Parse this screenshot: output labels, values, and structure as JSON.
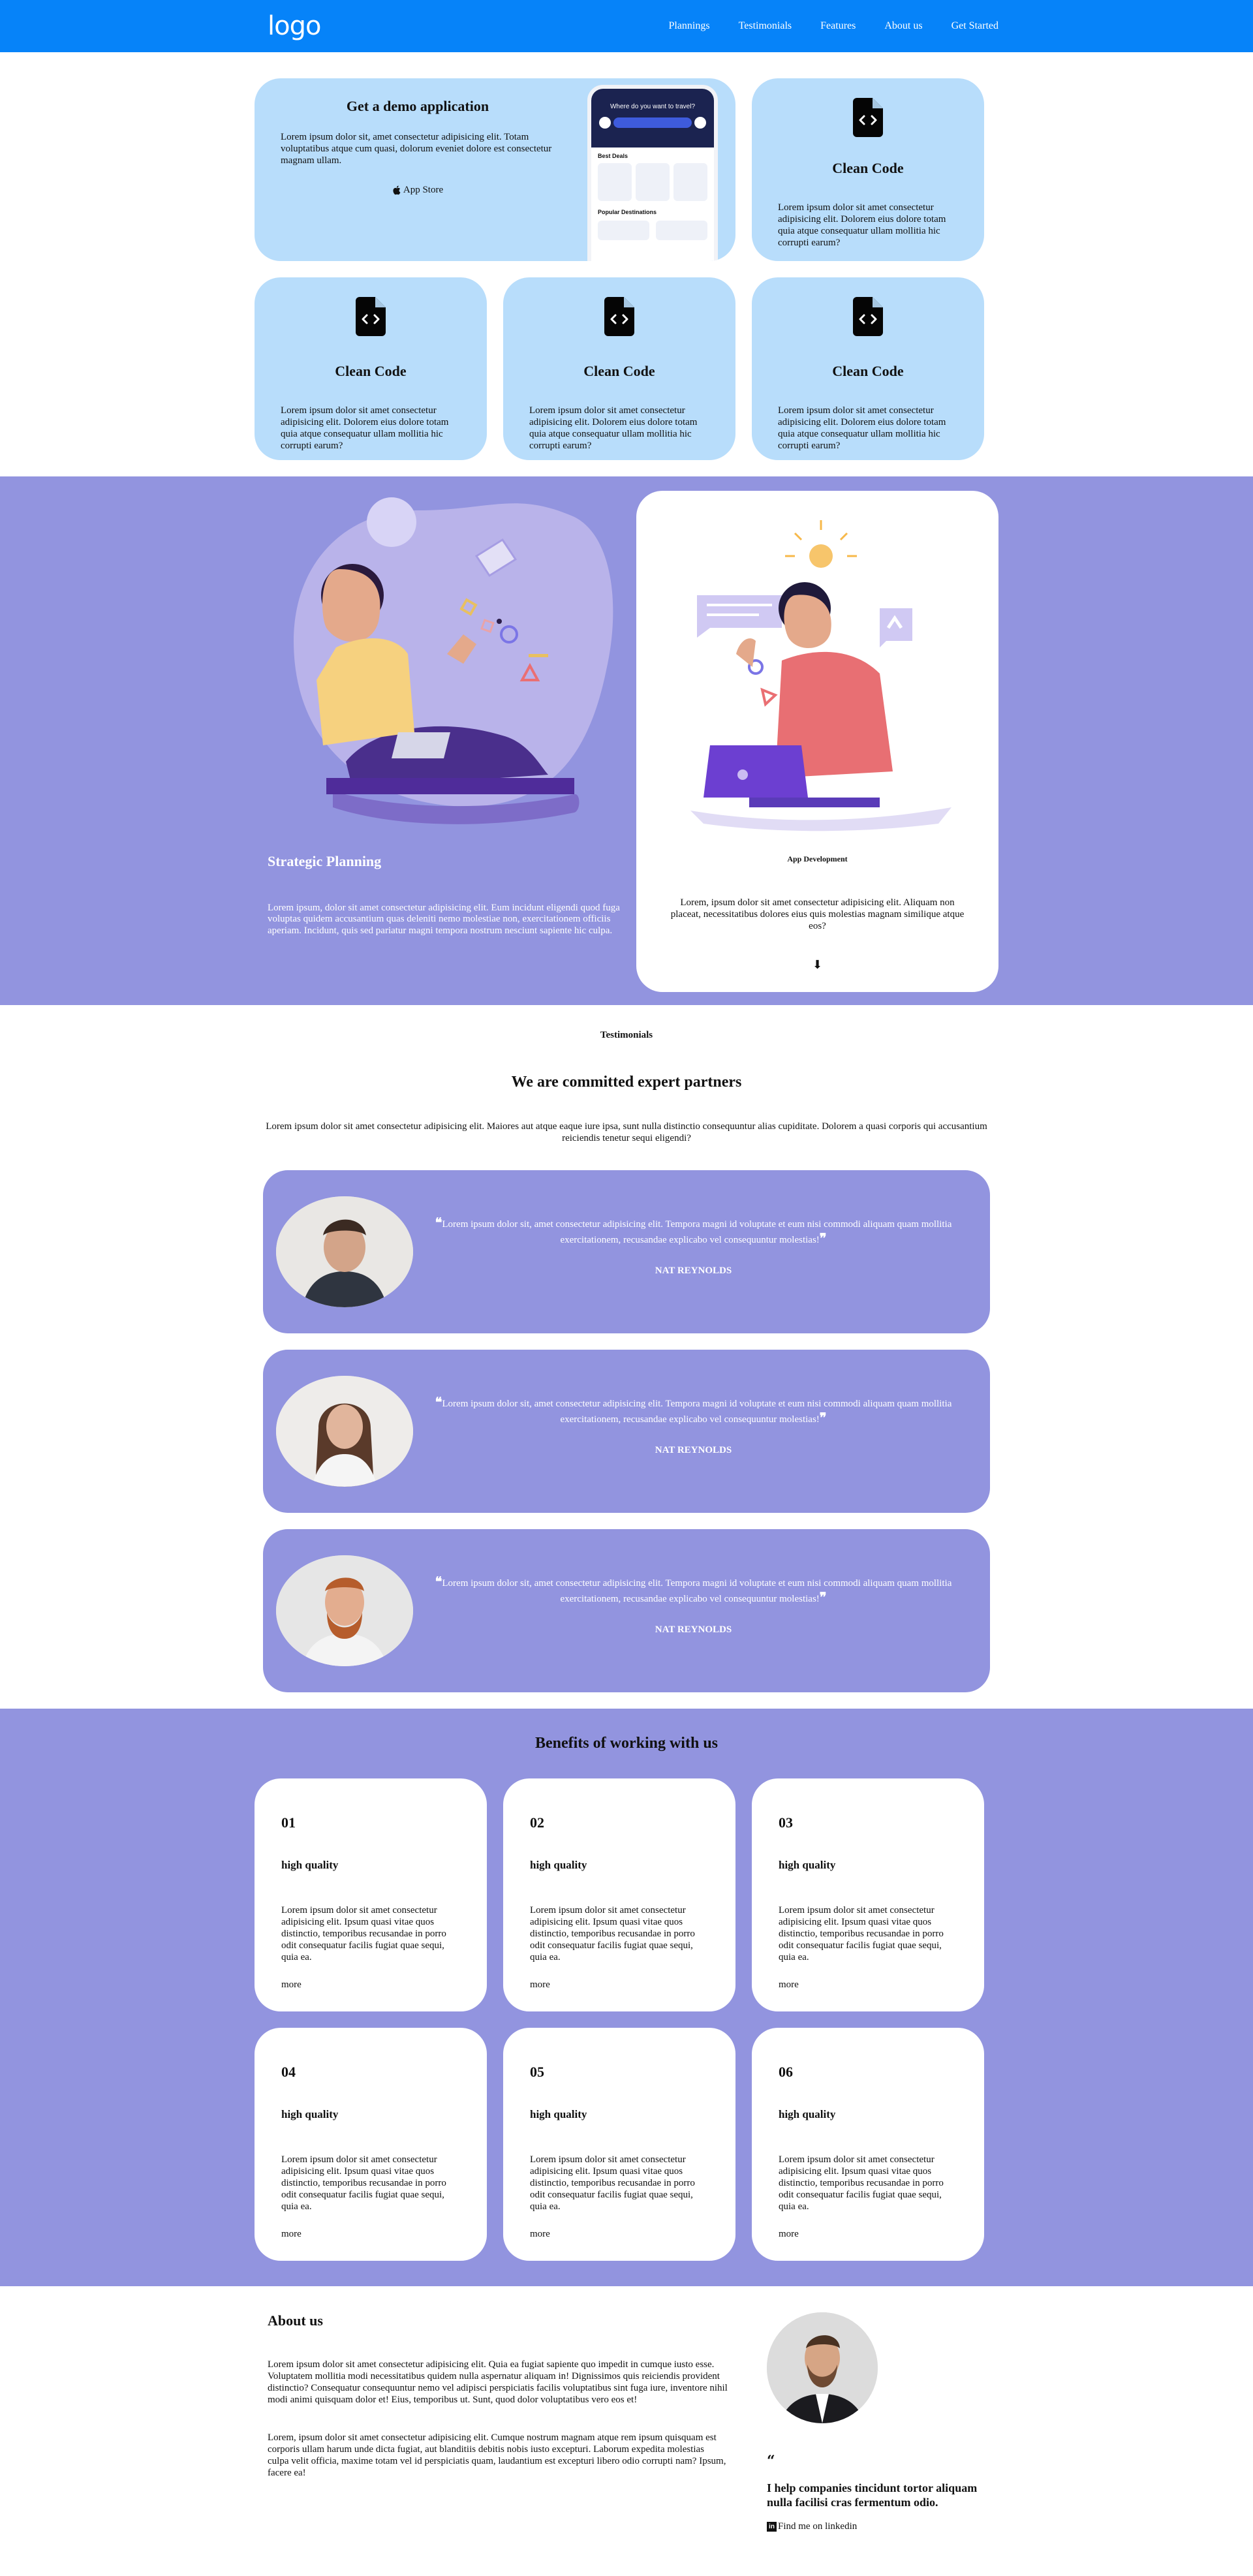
{
  "nav": {
    "logo": "logo",
    "links": [
      "Plannings",
      "Testimonials",
      "Features",
      "About us",
      "Get Started"
    ],
    "bg_color": "#0683f9"
  },
  "demo": {
    "title": "Get a demo application",
    "text": "Lorem ipsum dolor sit, amet consectetur adipisicing elit. Totam voluptatibus atque cum quasi, dolorum eveniet dolore est consectetur magnam ullam.",
    "store_label": "App Store",
    "phone": {
      "question": "Where do you want to travel?",
      "best_deals": "Best Deals",
      "popular": "Popular Destinations"
    }
  },
  "code_cards": [
    {
      "title": "Clean Code",
      "text": "Lorem ipsum dolor sit amet consectetur adipisicing elit. Dolorem eius dolore totam quia atque consequatur ullam mollitia hic corrupti earum?"
    },
    {
      "title": "Clean Code",
      "text": "Lorem ipsum dolor sit amet consectetur adipisicing elit. Dolorem eius dolore totam quia atque consequatur ullam mollitia hic corrupti earum?"
    },
    {
      "title": "Clean Code",
      "text": "Lorem ipsum dolor sit amet consectetur adipisicing elit. Dolorem eius dolore totam quia atque consequatur ullam mollitia hic corrupti earum?"
    },
    {
      "title": "Clean Code",
      "text": "Lorem ipsum dolor sit amet consectetur adipisicing elit. Dolorem eius dolore totam quia atque consequatur ullam mollitia hic corrupti earum?"
    }
  ],
  "strategy": {
    "title": "Strategic Planning",
    "text": "Lorem ipsum, dolor sit amet consectetur adipisicing elit. Eum incidunt eligendi quod fuga voluptas quidem accusantium quas deleniti nemo molestiae non, exercitationem officiis aperiam. Incidunt, quis sed pariatur magni tempora nostrum nesciunt sapiente hic culpa.",
    "card_title": "App Development",
    "card_text": "Lorem, ipsum dolor sit amet consectetur adipisicing elit. Aliquam non placeat, necessitatibus dolores eius quis molestias magnam similique atque eos?",
    "arrow_icon": "arrow-down-icon",
    "bg_color": "#9294df"
  },
  "testimonials": {
    "eyebrow": "Testimonials",
    "title": "We are committed expert partners",
    "intro": "Lorem ipsum dolor sit amet consectetur adipisicing elit. Maiores aut atque eaque iure ipsa, sunt nulla distinctio consequuntur alias cupiditate. Dolorem a quasi corporis qui accusantium reiciendis tenetur sequi eligendi?",
    "items": [
      {
        "quote": "Lorem ipsum dolor sit, amet consectetur adipisicing elit. Tempora magni id voluptate et eum nisi commodi aliquam quam mollitia exercitationem, recusandae explicabo vel consequuntur molestias!",
        "name": "NAT REYNOLDS"
      },
      {
        "quote": "Lorem ipsum dolor sit, amet consectetur adipisicing elit. Tempora magni id voluptate et eum nisi commodi aliquam quam mollitia exercitationem, recusandae explicabo vel consequuntur molestias!",
        "name": "NAT REYNOLDS"
      },
      {
        "quote": "Lorem ipsum dolor sit, amet consectetur adipisicing elit. Tempora magni id voluptate et eum nisi commodi aliquam quam mollitia exercitationem, recusandae explicabo vel consequuntur molestias!",
        "name": "NAT REYNOLDS"
      }
    ]
  },
  "benefits": {
    "title": "Benefits of working with us",
    "items": [
      {
        "num": "01",
        "title": "high quality",
        "text": "Lorem ipsum dolor sit amet consectetur adipisicing elit. Ipsum quasi vitae quos distinctio, temporibus recusandae in porro odit consequatur facilis fugiat quae sequi, quia ea.",
        "more": "more"
      },
      {
        "num": "02",
        "title": "high quality",
        "text": "Lorem ipsum dolor sit amet consectetur adipisicing elit. Ipsum quasi vitae quos distinctio, temporibus recusandae in porro odit consequatur facilis fugiat quae sequi, quia ea.",
        "more": "more"
      },
      {
        "num": "03",
        "title": "high quality",
        "text": "Lorem ipsum dolor sit amet consectetur adipisicing elit. Ipsum quasi vitae quos distinctio, temporibus recusandae in porro odit consequatur facilis fugiat quae sequi, quia ea.",
        "more": "more"
      },
      {
        "num": "04",
        "title": "high quality",
        "text": "Lorem ipsum dolor sit amet consectetur adipisicing elit. Ipsum quasi vitae quos distinctio, temporibus recusandae in porro odit consequatur facilis fugiat quae sequi, quia ea.",
        "more": "more"
      },
      {
        "num": "05",
        "title": "high quality",
        "text": "Lorem ipsum dolor sit amet consectetur adipisicing elit. Ipsum quasi vitae quos distinctio, temporibus recusandae in porro odit consequatur facilis fugiat quae sequi, quia ea.",
        "more": "more"
      },
      {
        "num": "06",
        "title": "high quality",
        "text": "Lorem ipsum dolor sit amet consectetur adipisicing elit. Ipsum quasi vitae quos distinctio, temporibus recusandae in porro odit consequatur facilis fugiat quae sequi, quia ea.",
        "more": "more"
      }
    ]
  },
  "about": {
    "title": "About us",
    "p1": "Lorem ipsum dolor sit amet consectetur adipisicing elit. Quia ea fugiat sapiente quo impedit in cumque iusto esse. Voluptatem mollitia modi necessitatibus quidem nulla aspernatur aliquam in! Dignissimos quis reiciendis provident distinctio? Consequatur consequuntur nemo vel adipisci perspiciatis facilis voluptatibus sint fuga iure, inventore nihil modi animi quisquam dolor et! Eius, temporibus ut. Sunt, quod dolor voluptatibus vero eos et!",
    "p2": "Lorem, ipsum dolor sit amet consectetur adipisicing elit. Cumque nostrum magnam atque rem ipsum quisquam est corporis ullam harum unde dicta fugiat, aut blanditiis debitis nobis iusto excepturi. Laborum expedita molestias culpa velit officia, maxime totam vel id perspiciatis quam, laudantium est excepturi libero odio corrupti nam? Ipsum, facere ea!",
    "quote_mark": "“",
    "tagline": "I help companies tincidunt tortor aliquam nulla facilisi cras fermentum odio.",
    "linkedin_icon": "in",
    "linkedin": "Find me on linkedin"
  }
}
